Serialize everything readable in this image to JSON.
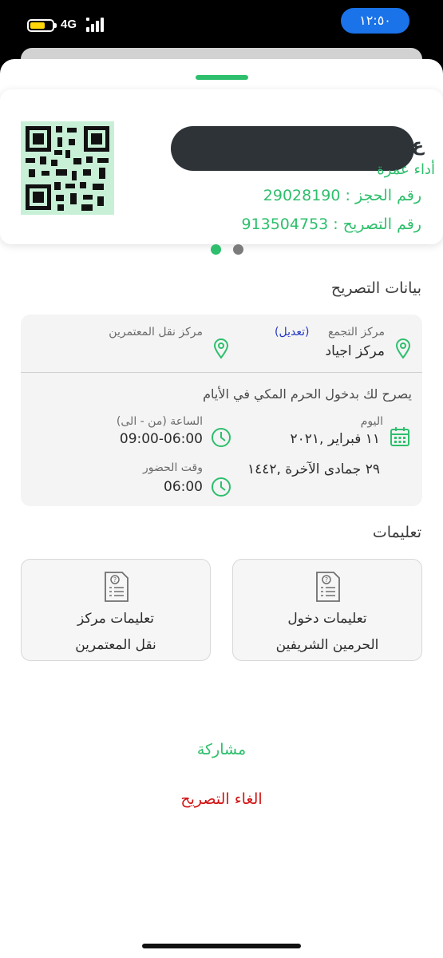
{
  "status": {
    "network": "4G",
    "time": "١٢:٥٠",
    "battery_color": "#ffd60a"
  },
  "permit": {
    "name_tail": "ع",
    "type": "أداء عمرة",
    "booking_number": "رقم الحجز : 29028190",
    "permit_number": "رقم التصريح : 913504753"
  },
  "details": {
    "title": "بيانات التصريح",
    "gathering_label": "مركز التجمع",
    "edit_label": "(تعديل)",
    "gathering_value": "مركز اجياد",
    "transport_label": "مركز نقل المعتمرين",
    "permission_text": "يصرح لك بدخول الحرم المكي في الأيام",
    "day_label": "اليوم",
    "day_value": "١١ فبراير ,٢٠٢١",
    "hijri_value": "٢٩ جمادى الآخرة ,١٤٤٢",
    "hours_label": "الساعة (من - الى)",
    "hours_value": "09:00-06:00",
    "attendance_label": "وقت الحضور",
    "attendance_value": "06:00"
  },
  "instructions": {
    "title": "تعليمات",
    "tiles": [
      {
        "line1": "تعليمات دخول",
        "line2": "الحرمين الشريفين"
      },
      {
        "line1": "تعليمات مركز",
        "line2": "نقل المعتمرين"
      }
    ]
  },
  "actions": {
    "share": "مشاركة",
    "cancel": "الغاء التصريح"
  },
  "colors": {
    "accent_green": "#2dbf6c",
    "link_blue": "#2337c6",
    "danger_red": "#d21414",
    "time_pill": "#1a73e8"
  }
}
